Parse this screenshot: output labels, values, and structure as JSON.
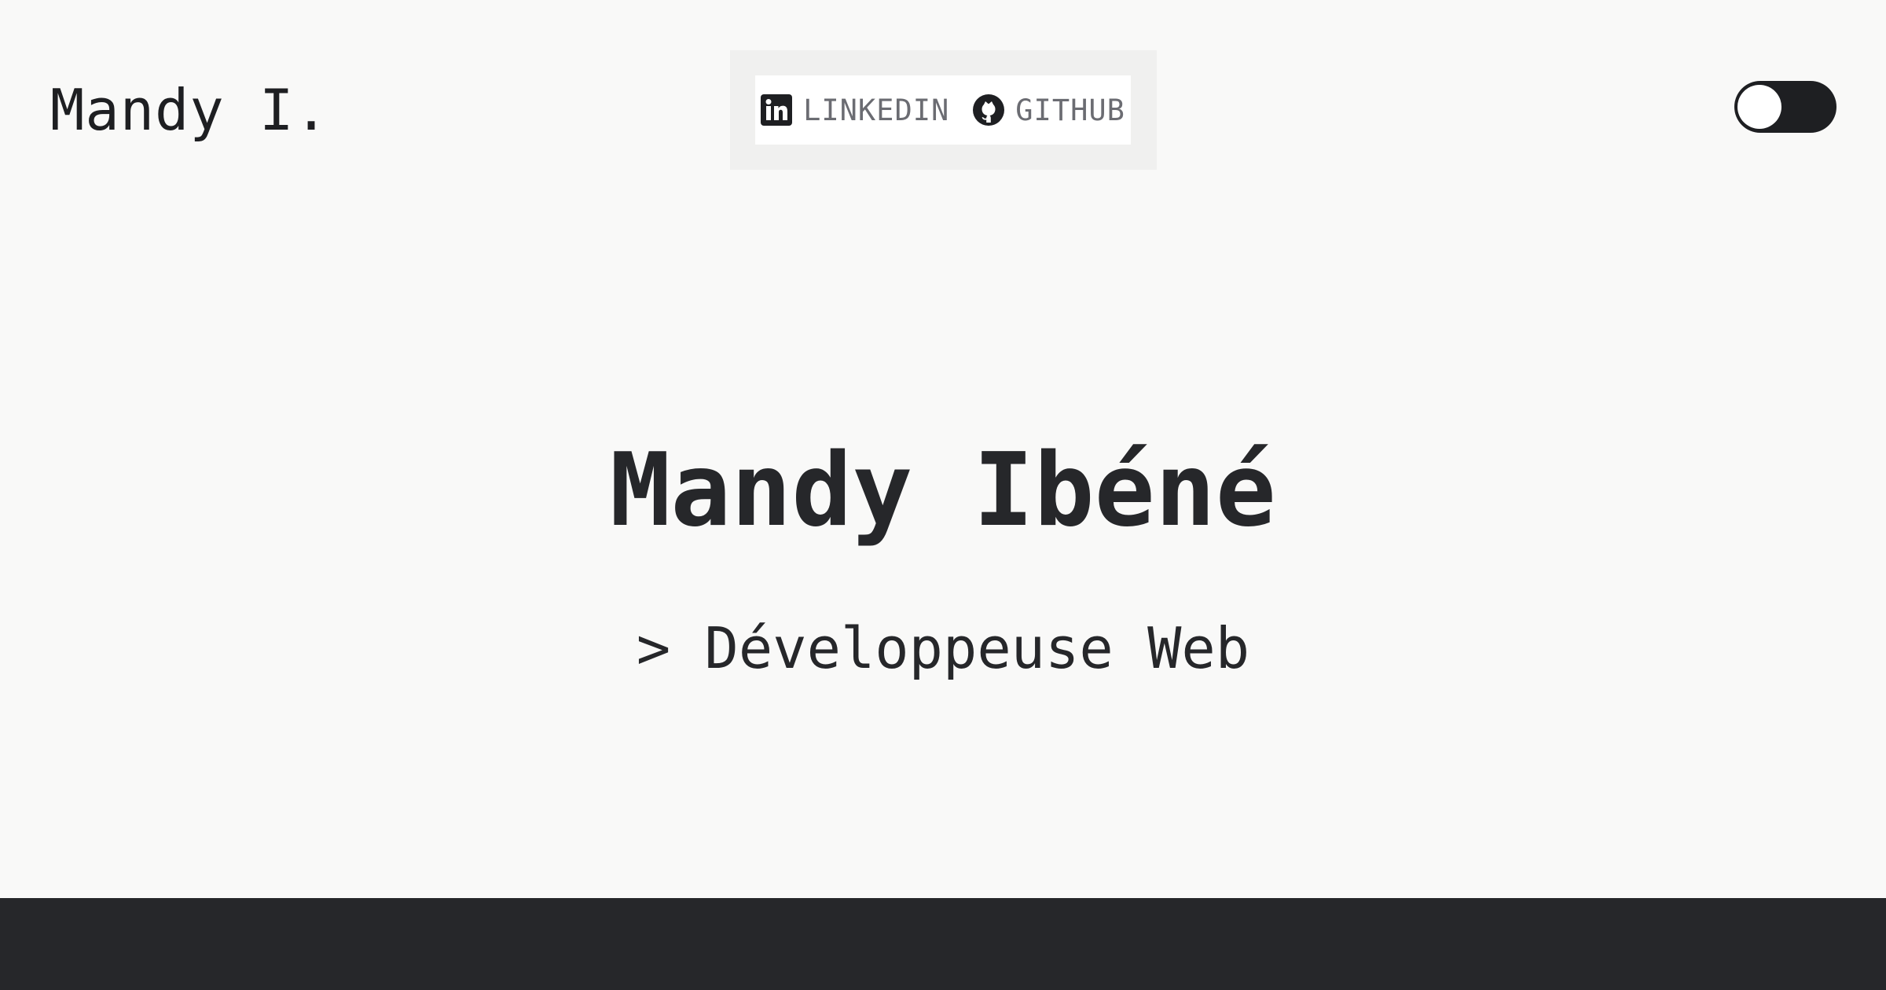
{
  "header": {
    "logo_text": "Mandy I.",
    "social_links": [
      {
        "label": "LINKEDIN",
        "icon": "linkedin-icon"
      },
      {
        "label": "GITHUB",
        "icon": "github-icon"
      }
    ]
  },
  "hero": {
    "name": "Mandy Ibéné",
    "role": "> Développeuse Web"
  },
  "colors": {
    "background": "#f9f9f8",
    "text": "#26272a",
    "link_text": "#6b6c72",
    "footer": "#26272a",
    "toggle": "#1e1f22"
  }
}
